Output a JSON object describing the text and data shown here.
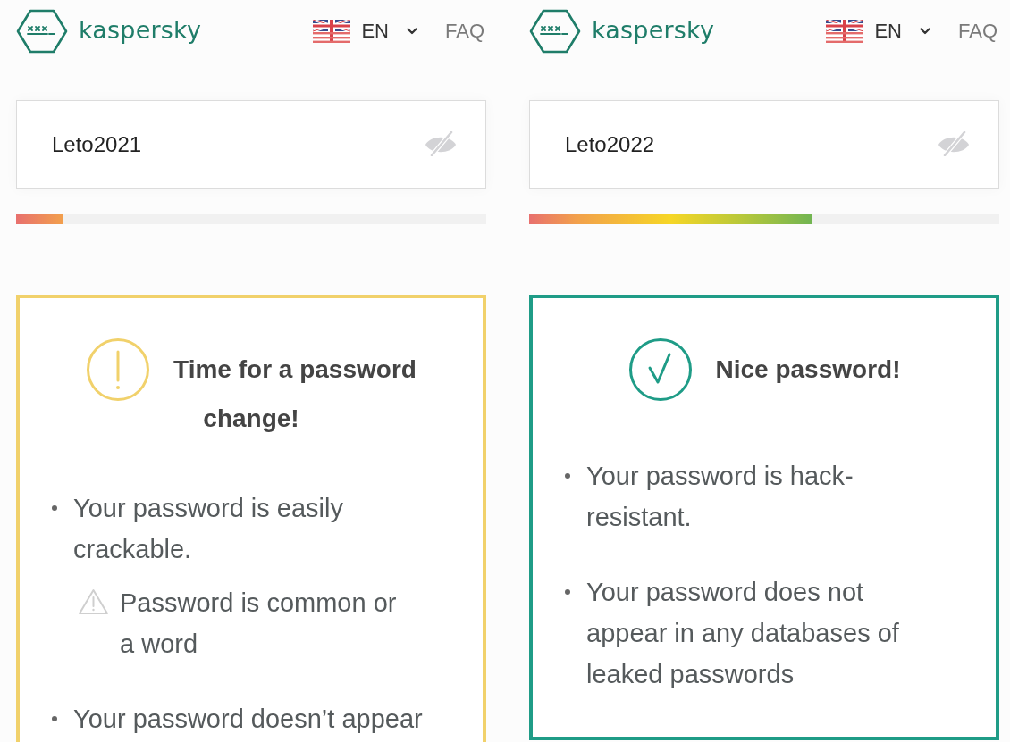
{
  "panels": [
    {
      "header": {
        "logo_text": "kaspersky",
        "language": "EN",
        "faq": "FAQ"
      },
      "password": {
        "value": "Leto2021"
      },
      "strength": {
        "level": 0.1
      },
      "result": {
        "kind": "warning",
        "title": "Time for a password change!",
        "items": [
          {
            "text": "Your password is easily crackable.",
            "children": [
              {
                "text": "Password is common or a word"
              }
            ]
          },
          {
            "text": "Your password doesn’t appear"
          }
        ]
      }
    },
    {
      "header": {
        "logo_text": "kaspersky",
        "language": "EN",
        "faq": "FAQ"
      },
      "password": {
        "value": "Leto2022"
      },
      "strength": {
        "level": 0.6
      },
      "result": {
        "kind": "success",
        "title": "Nice password!",
        "items": [
          {
            "text": "Your password is hack-resistant."
          },
          {
            "text": "Your password does not appear in any databases of leaked passwords"
          }
        ]
      }
    }
  ]
}
